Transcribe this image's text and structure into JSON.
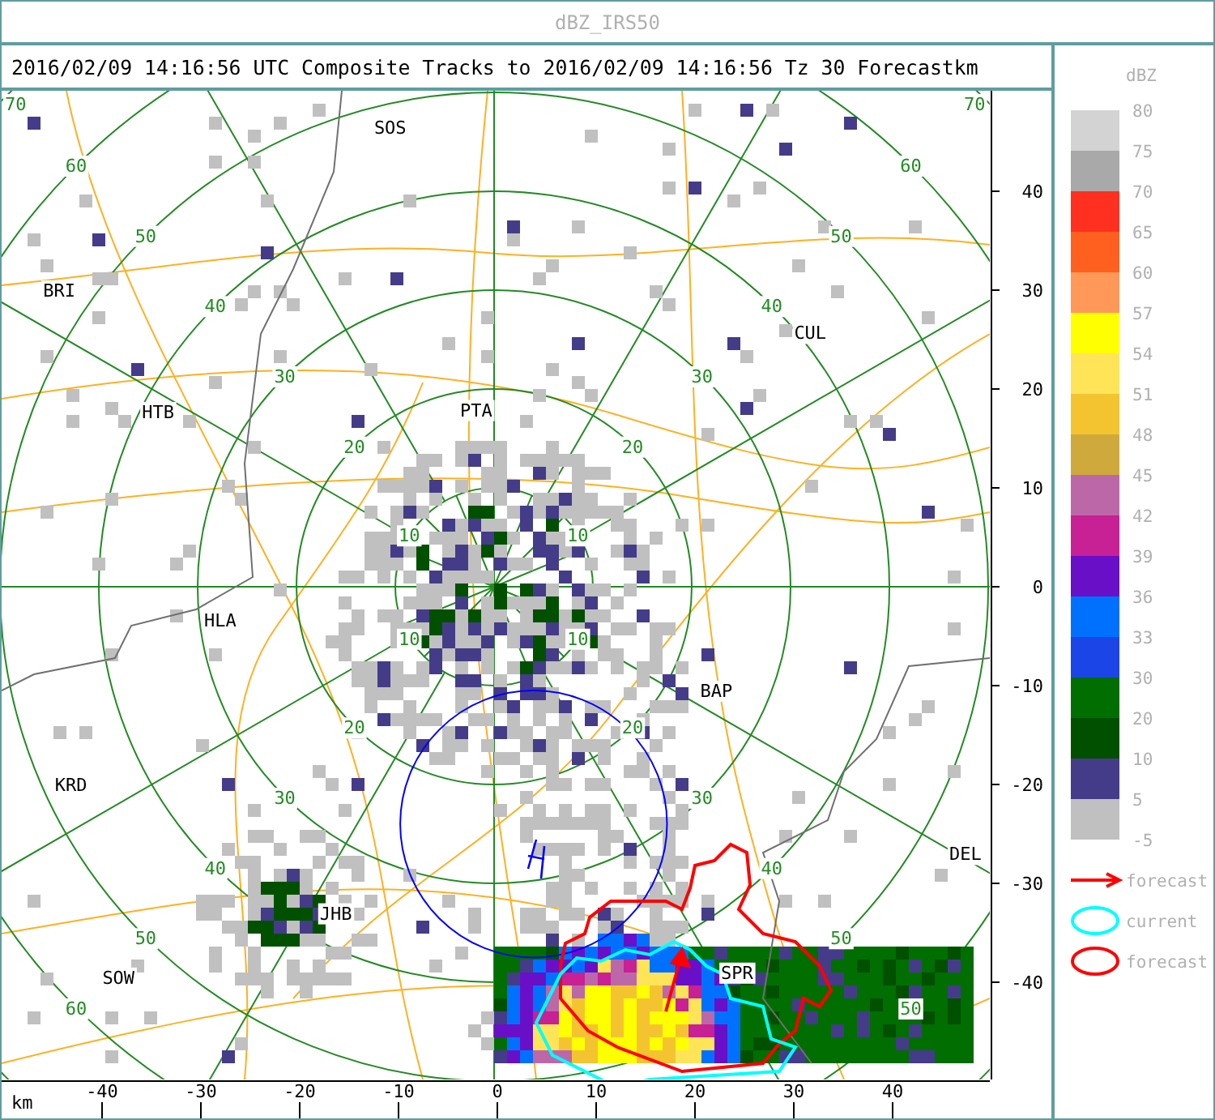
{
  "title": "dBZ_IRS50",
  "header": "2016/02/09 14:16:56 UTC Composite Tracks to 2016/02/09 14:16:56 Tz 30 Forecast",
  "map": {
    "towns": [
      {
        "name": "SOS"
      },
      {
        "name": "BRI"
      },
      {
        "name": "CUL"
      },
      {
        "name": "HTB"
      },
      {
        "name": "PTA"
      },
      {
        "name": "HLA"
      },
      {
        "name": "BAP"
      },
      {
        "name": "KRD"
      },
      {
        "name": "DEL"
      },
      {
        "name": "JHB"
      },
      {
        "name": "SOW"
      },
      {
        "name": "SPR"
      }
    ],
    "ring_labels": {
      "ne": [
        "10",
        "20",
        "30",
        "40",
        "50",
        "60",
        "70"
      ],
      "nw": [
        "10",
        "20",
        "30",
        "40",
        "50",
        "60",
        "70"
      ],
      "sw": [
        "10",
        "20",
        "30",
        "40",
        "50",
        "60"
      ],
      "se": [
        "10",
        "20",
        "30",
        "40",
        "50",
        "50"
      ]
    }
  },
  "y_axis": {
    "unit": "km",
    "ticks": [
      "40",
      "30",
      "20",
      "10",
      "0",
      "-10",
      "-20",
      "-30",
      "-40"
    ]
  },
  "x_axis": {
    "unit": "km",
    "ticks": [
      "-40",
      "-30",
      "-20",
      "-10",
      "0",
      "10",
      "20",
      "30",
      "40"
    ]
  },
  "legend": {
    "unit": "dBZ",
    "labels": [
      "80",
      "75",
      "70",
      "65",
      "60",
      "57",
      "54",
      "51",
      "48",
      "45",
      "42",
      "39",
      "36",
      "33",
      "30",
      "20",
      "10",
      "5",
      "-5"
    ],
    "bands": [
      {
        "color": "#d3d3d3"
      },
      {
        "color": "#a9a9a9"
      },
      {
        "color": "#ff3020"
      },
      {
        "color": "#ff6020"
      },
      {
        "color": "#ff9858"
      },
      {
        "color": "#ffff00"
      },
      {
        "color": "#ffe458"
      },
      {
        "color": "#f4c430"
      },
      {
        "color": "#cfa93c"
      },
      {
        "color": "#bc68a8"
      },
      {
        "color": "#c82095"
      },
      {
        "color": "#6a0fc8"
      },
      {
        "color": "#0070ff"
      },
      {
        "color": "#1c45e8"
      },
      {
        "color": "#006e00"
      },
      {
        "color": "#005000"
      },
      {
        "color": "#443c88"
      },
      {
        "color": "#c0c0c0"
      }
    ],
    "keys": [
      {
        "kind": "arrow",
        "label": "forecast",
        "color": "#ff0000"
      },
      {
        "kind": "ellipse",
        "label": "current",
        "color": "#00ffff"
      },
      {
        "kind": "ellipse",
        "label": "forecast",
        "color": "#ff0000"
      }
    ]
  }
}
